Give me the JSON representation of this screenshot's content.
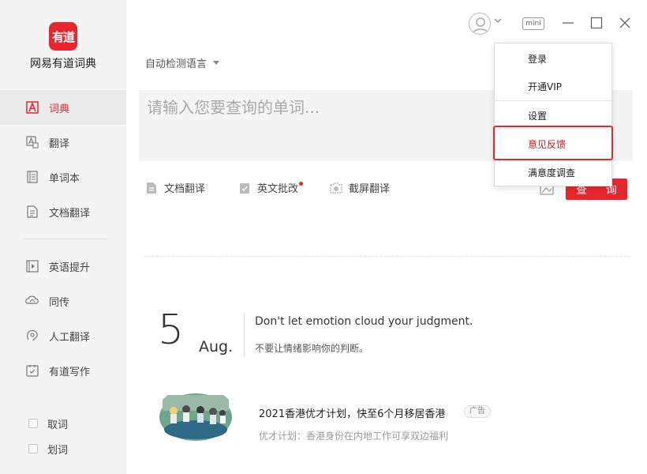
{
  "app": {
    "logo_text": "有道",
    "name": "网易有道词典"
  },
  "sidebar": {
    "items": [
      {
        "label": "词典",
        "icon": "dict-icon",
        "active": true
      },
      {
        "label": "翻译",
        "icon": "translate-icon"
      },
      {
        "label": "单词本",
        "icon": "wordbook-icon"
      },
      {
        "label": "文档翻译",
        "icon": "doc-translate-icon"
      },
      {
        "label": "英语提升",
        "icon": "play-icon"
      },
      {
        "label": "同传",
        "icon": "interpret-icon"
      },
      {
        "label": "人工翻译",
        "icon": "human-translate-icon"
      },
      {
        "label": "有道写作",
        "icon": "writing-icon"
      }
    ],
    "checks": [
      {
        "label": "取词",
        "checked": false
      },
      {
        "label": "划词",
        "checked": false
      }
    ]
  },
  "titlebar": {
    "mini_label": "mini"
  },
  "lang_select": {
    "value": "自动检测语言"
  },
  "search": {
    "placeholder": "请输入您要查询的单词..."
  },
  "tools": {
    "doc": "文档翻译",
    "correct": "英文批改",
    "screenshot": "截屏翻译",
    "query_button": "查 询"
  },
  "daily": {
    "day": "5",
    "month": "Aug.",
    "sentence_en": "Don't let emotion cloud your judgment.",
    "sentence_cn": "不要让情绪影响你的判断。"
  },
  "ad": {
    "title": "2021香港优才计划，快至6个月移居香港",
    "badge": "广告",
    "subtitle": "优才计划：香港身份在内地工作可享双边福利"
  },
  "dropdown": {
    "items": [
      "登录",
      "开通VIP",
      "设置",
      "意见反馈",
      "满意度调查"
    ],
    "highlighted": "意见反馈"
  },
  "colors": {
    "accent": "#e8262d",
    "sidebar_bg": "#f4f4f4"
  }
}
